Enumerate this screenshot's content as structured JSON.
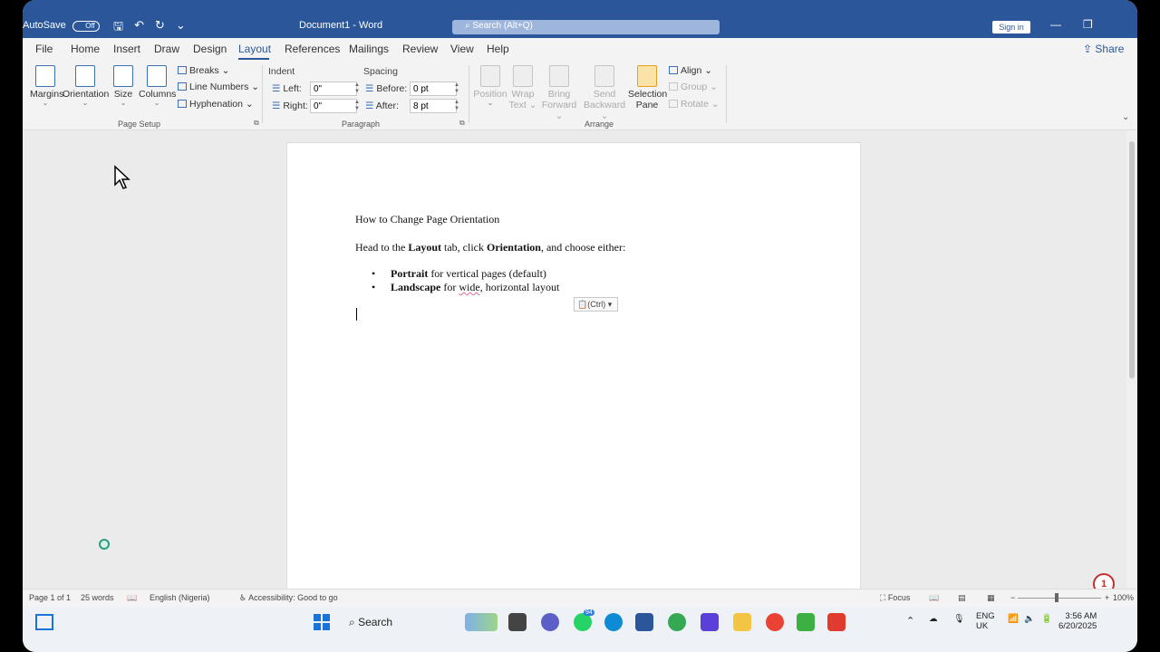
{
  "window": {
    "autosave_label": "AutoSave",
    "autosave_state": "Off",
    "title": "Document1 - Word",
    "search_placeholder": "Search (Alt+Q)",
    "signin_label": "Sign in"
  },
  "menu": {
    "tabs": [
      "File",
      "Home",
      "Insert",
      "Draw",
      "Design",
      "Layout",
      "References",
      "Mailings",
      "Review",
      "View",
      "Help"
    ],
    "active": "Layout",
    "share_label": "Share"
  },
  "ribbon": {
    "page_setup": {
      "margins": "Margins",
      "orientation": "Orientation",
      "size": "Size",
      "columns": "Columns",
      "breaks": "Breaks",
      "line_numbers": "Line Numbers",
      "hyphenation": "Hyphenation",
      "group_label": "Page Setup"
    },
    "paragraph": {
      "indent_label": "Indent",
      "spacing_label": "Spacing",
      "left_label": "Left:",
      "left_value": "0\"",
      "right_label": "Right:",
      "right_value": "0\"",
      "before_label": "Before:",
      "before_value": "0 pt",
      "after_label": "After:",
      "after_value": "8 pt",
      "group_label": "Paragraph"
    },
    "arrange": {
      "position": "Position",
      "wrap_text_1": "Wrap",
      "wrap_text_2": "Text",
      "bring_forward_1": "Bring",
      "bring_forward_2": "Forward",
      "send_backward_1": "Send",
      "send_backward_2": "Backward",
      "selection_pane_1": "Selection",
      "selection_pane_2": "Pane",
      "align": "Align",
      "group": "Group",
      "rotate": "Rotate",
      "group_label": "Arrange"
    }
  },
  "document": {
    "title": "How to Change Page Orientation",
    "intro_1": "Head to the ",
    "intro_bold_1": "Layout",
    "intro_2": " tab, click ",
    "intro_bold_2": "Orientation",
    "intro_3": ", and choose either:",
    "bullets": [
      {
        "bold": "Portrait",
        "text_a": " for vertical pages (default)",
        "squiggle": "",
        "text_b": ""
      },
      {
        "bold": "Landscape",
        "text_a": " for ",
        "squiggle": "wide",
        "text_b": ", horizontal layout"
      }
    ],
    "paste_options": "(Ctrl)"
  },
  "notification_badge": "1",
  "status": {
    "page": "Page 1 of 1",
    "words": "25 words",
    "language": "English (Nigeria)",
    "accessibility": "Accessibility: Good to go",
    "focus": "Focus",
    "zoom": "100%"
  },
  "taskbar": {
    "search": "Search",
    "whatsapp_badge": "94",
    "lang_1": "ENG",
    "lang_2": "UK",
    "time": "3:56 AM",
    "date": "6/20/2025"
  }
}
